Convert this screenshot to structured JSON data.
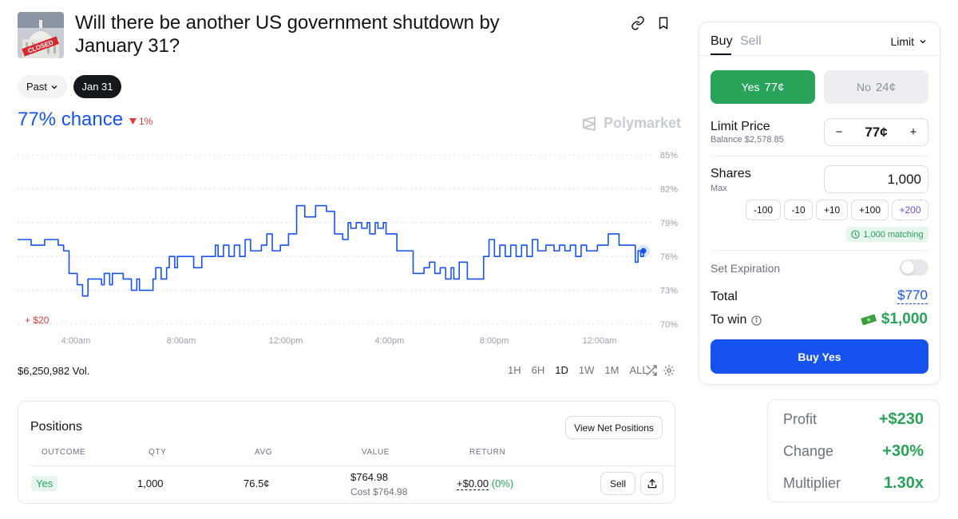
{
  "market": {
    "title": "Will there be another US government shutdown by January 31?",
    "thumbnail_stamp": "CLOSED",
    "icons": [
      "link-icon",
      "bookmark-icon"
    ]
  },
  "filters": {
    "past_label": "Past",
    "date_label": "Jan 31"
  },
  "probability": {
    "chance_text": "77% chance",
    "change_text": "1%",
    "change_direction": "down"
  },
  "brand": {
    "name": "Polymarket"
  },
  "chart_data": {
    "type": "line",
    "title": "",
    "xlabel": "",
    "ylabel": "",
    "x_ticks": [
      "4:00am",
      "8:00am",
      "12:00pm",
      "4:00pm",
      "8:00pm",
      "12:00am"
    ],
    "y_ticks": [
      "85%",
      "82%",
      "79%",
      "76%",
      "73%",
      "70%"
    ],
    "ylim": [
      70,
      85
    ],
    "grid": true,
    "annotation": "+ $20",
    "series": [
      {
        "color": "#1652f0",
        "x": [
          0,
          0.5,
          1,
          1.5,
          1.7,
          1.9,
          2.2,
          2.4,
          2.6,
          3.1,
          3.2,
          3.4,
          3.5,
          3.9,
          4.2,
          4.4,
          4.5,
          4.7,
          5.0,
          5.1,
          5.3,
          5.5,
          5.6,
          5.8,
          5.9,
          6.2,
          6.5,
          6.8,
          7.2,
          7.3,
          7.4,
          7.6,
          7.8,
          8.0,
          8.2,
          8.4,
          8.6,
          9.0,
          9.2,
          9.4,
          9.7,
          10.0,
          10.3,
          10.6,
          11.0,
          11.4,
          11.7,
          12.0,
          12.2,
          12.3,
          12.5,
          12.7,
          12.9,
          13.0,
          13.2,
          13.3,
          13.5,
          13.6,
          14.0,
          14.6,
          15.0,
          15.2,
          15.4,
          15.6,
          15.8,
          16.0,
          16.1,
          16.3,
          16.6,
          17.0,
          17.2,
          17.4,
          17.6,
          17.8,
          18.0,
          18.2,
          18.4,
          18.6,
          18.8,
          19.0,
          19.2,
          19.5,
          19.8,
          20.0,
          20.2,
          20.4,
          20.6,
          20.8,
          21.0,
          21.4,
          21.8,
          22.2,
          22.6,
          22.8,
          22.9,
          23.0,
          23.1
        ],
        "y": [
          77.5,
          77.0,
          77.5,
          77.0,
          76.5,
          74.5,
          73.5,
          72.5,
          74.0,
          73.5,
          74.5,
          73.5,
          74.5,
          74.0,
          73.0,
          74.0,
          73.0,
          73.0,
          74.0,
          75.0,
          74.0,
          75.0,
          76.0,
          75.0,
          76.0,
          76.0,
          75.0,
          76.0,
          76.0,
          77.0,
          76.0,
          77.0,
          76.0,
          77.0,
          76.0,
          77.5,
          76.5,
          77.0,
          78.0,
          76.5,
          77.0,
          78.0,
          80.5,
          79.5,
          80.5,
          80.0,
          78.0,
          77.5,
          79.0,
          78.5,
          79.0,
          78.5,
          79.0,
          78.0,
          79.0,
          78.5,
          79.0,
          78.0,
          76.5,
          74.5,
          75.0,
          75.5,
          74.5,
          75.0,
          74.0,
          75.0,
          74.0,
          75.5,
          74.0,
          74.0,
          76.0,
          77.5,
          76.0,
          77.0,
          76.0,
          77.0,
          76.0,
          77.0,
          76.0,
          77.5,
          76.5,
          77.0,
          76.5,
          77.0,
          76.5,
          77.0,
          76.0,
          77.0,
          76.5,
          77.0,
          78.0,
          77.0,
          77.0,
          75.5,
          76.5,
          76.0,
          76.5
        ]
      }
    ]
  },
  "volume": {
    "text": "$6,250,982 Vol."
  },
  "ranges": {
    "options": [
      "1H",
      "6H",
      "1D",
      "1W",
      "1M",
      "ALL"
    ],
    "selected": "1D"
  },
  "positions": {
    "title": "Positions",
    "view_net_label": "View Net Positions",
    "columns": [
      "OUTCOME",
      "QTY",
      "AVG",
      "VALUE",
      "RETURN"
    ],
    "rows": [
      {
        "outcome": "Yes",
        "qty": "1,000",
        "avg": "76.5¢",
        "value": "$764.98",
        "cost": "Cost $764.98",
        "return_amount": "+$0.00",
        "return_pct": "(0%)",
        "sell_label": "Sell"
      }
    ]
  },
  "trade": {
    "tabs": {
      "buy": "Buy",
      "sell": "Sell"
    },
    "order_type": "Limit",
    "yes": {
      "label": "Yes",
      "price": "77¢"
    },
    "no": {
      "label": "No",
      "price": "24¢"
    },
    "limit_price": {
      "label": "Limit Price",
      "balance": "Balance $2,578.85",
      "value": "77¢",
      "minus": "−",
      "plus": "+"
    },
    "shares": {
      "label": "Shares",
      "sub": "Max",
      "value": "1,000"
    },
    "quick": [
      "-100",
      "-10",
      "+10",
      "+100",
      "+200"
    ],
    "matching": "1,000 matching",
    "expiration_label": "Set Expiration",
    "expiration_on": false,
    "total_label": "Total",
    "total_value": "$770",
    "to_win_label": "To win",
    "to_win_value": "$1,000",
    "buy_button": "Buy Yes"
  },
  "summary": {
    "profit_label": "Profit",
    "profit_value": "+$230",
    "change_label": "Change",
    "change_value": "+30%",
    "multiplier_label": "Multiplier",
    "multiplier_value": "1.30x"
  },
  "colors": {
    "accent_blue": "#1652f0",
    "green": "#27a35a",
    "red": "#e23b3b"
  }
}
